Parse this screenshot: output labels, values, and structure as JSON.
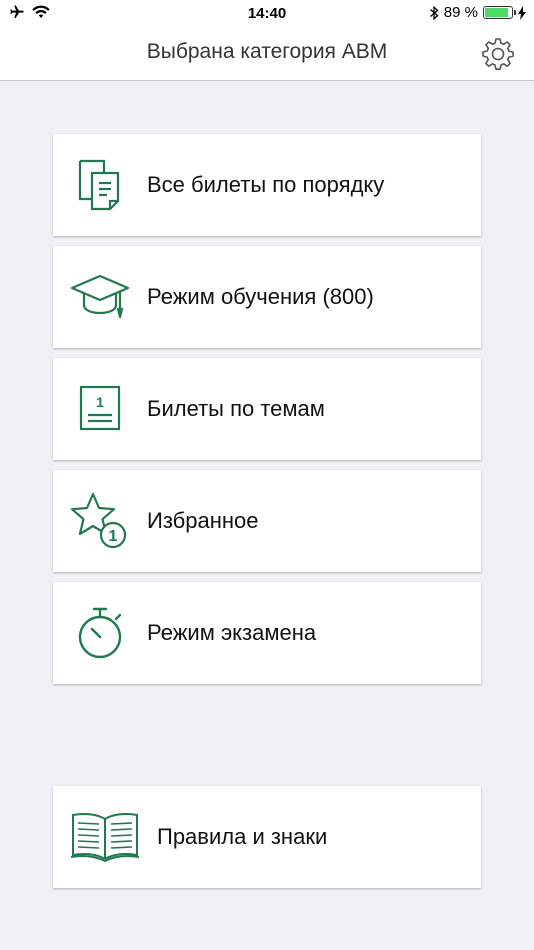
{
  "status_bar": {
    "time": "14:40",
    "battery_percent_text": "89 %",
    "battery_level": 0.89,
    "icons": [
      "airplane-icon",
      "wifi-icon",
      "bluetooth-icon",
      "battery-icon",
      "charging-icon"
    ]
  },
  "nav": {
    "title": "Выбрана категория ABM",
    "settings_icon": "gear-icon"
  },
  "menu": {
    "items": [
      {
        "label": "Все билеты по порядку",
        "icon": "documents-icon"
      },
      {
        "label": "Режим обучения (800)",
        "icon": "graduation-cap-icon"
      },
      {
        "label": "Билеты по темам",
        "icon": "numbered-document-icon",
        "icon_text": "1"
      },
      {
        "label": "Избранное",
        "icon": "star-badge-icon",
        "icon_text": "1"
      },
      {
        "label": "Режим экзамена",
        "icon": "stopwatch-icon"
      }
    ],
    "rules": {
      "label": "Правила и знаки",
      "icon": "open-book-icon"
    }
  },
  "colors": {
    "accent": "#1f7a4d",
    "background": "#efeff4",
    "card": "#ffffff"
  }
}
